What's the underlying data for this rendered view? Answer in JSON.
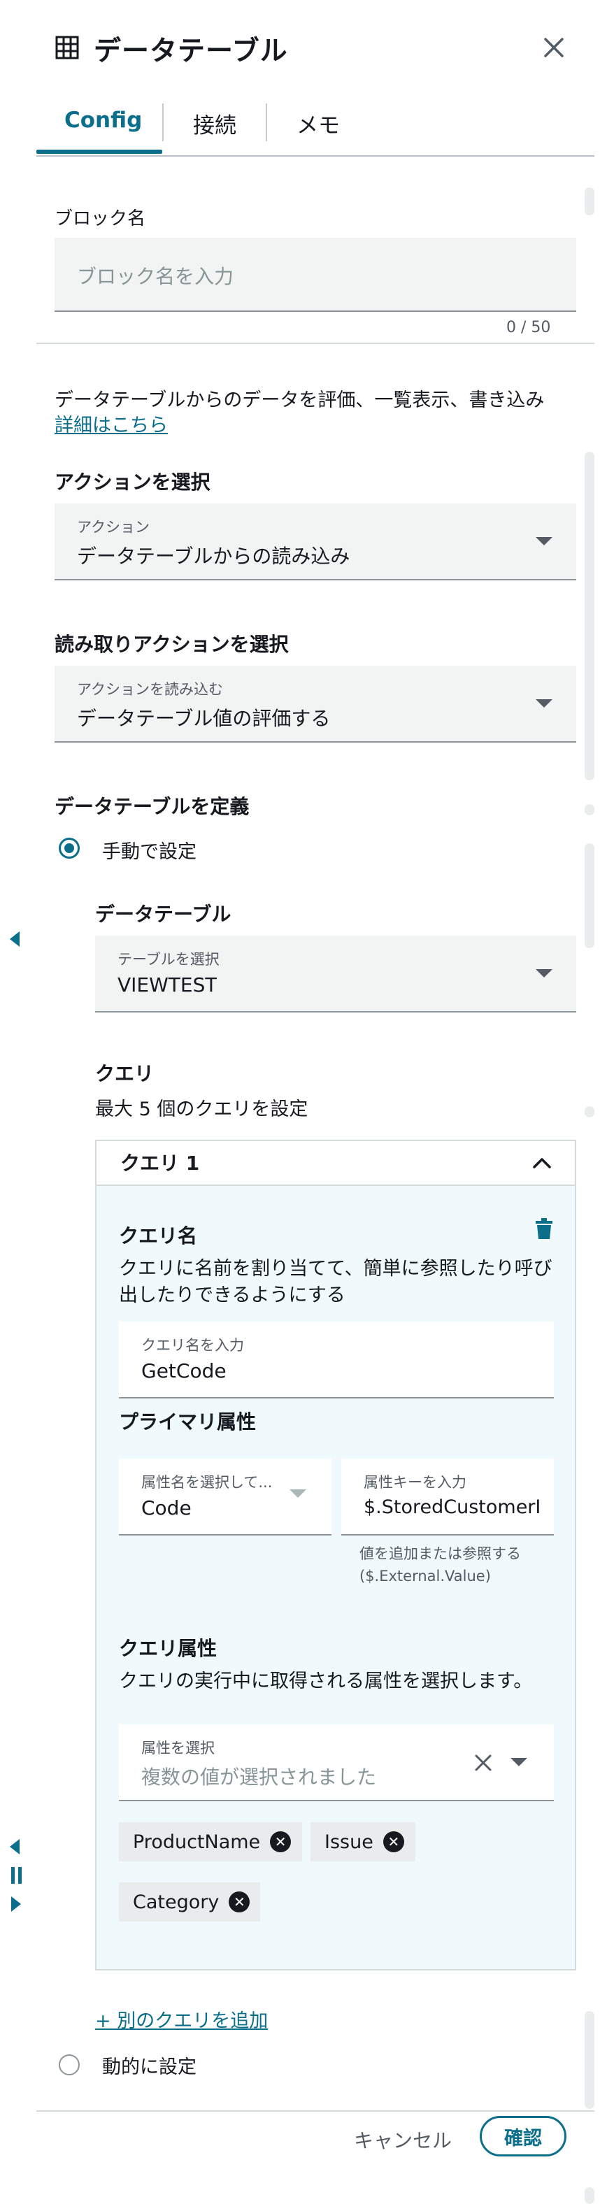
{
  "header": {
    "title": "データテーブル"
  },
  "tabs": [
    {
      "label": "Config"
    },
    {
      "label": "接続"
    },
    {
      "label": "メモ"
    }
  ],
  "block_name": {
    "label": "ブロック名",
    "placeholder": "ブロック名を入力",
    "counter": "0 / 50"
  },
  "intro": {
    "description": "データテーブルからのデータを評価、一覧表示、書き込み",
    "link": "詳細はこちら"
  },
  "action": {
    "heading": "アクションを選択",
    "field_label": "アクション",
    "value": "データテーブルからの読み込み"
  },
  "read_action": {
    "heading": "読み取りアクションを選択",
    "field_label": "アクションを読み込む",
    "value": "データテーブル値の評価する"
  },
  "define_table": {
    "heading": "データテーブルを定義",
    "manual_label": "手動で設定",
    "dynamic_label": "動的に設定"
  },
  "table": {
    "heading": "データテーブル",
    "field_label": "テーブルを選択",
    "value": "VIEWTEST"
  },
  "queries": {
    "heading": "クエリ",
    "subtext": "最大 5 個のクエリを設定",
    "add_link": "+ 別のクエリを追加",
    "items": [
      {
        "title": "クエリ 1",
        "name_heading": "クエリ名",
        "name_desc": "クエリに名前を割り当てて、簡単に参照したり呼び出したりできるようにする",
        "name_field_label": "クエリ名を入力",
        "name_value": "GetCode",
        "primary_heading": "プライマリ属性",
        "attr_name_label": "属性名を選択して...",
        "attr_name_value": "Code",
        "attr_key_label": "属性キーを入力",
        "attr_key_value": "$.StoredCustomerI",
        "attr_key_hint": "値を追加または参照する ($.External.Value)",
        "query_attrs_heading": "クエリ属性",
        "query_attrs_desc": "クエリの実行中に取得される属性を選択します。",
        "select_label": "属性を選択",
        "select_placeholder": "複数の値が選択されました",
        "tokens": [
          "ProductName",
          "Issue",
          "Category"
        ]
      }
    ]
  },
  "footer": {
    "cancel": "キャンセル",
    "confirm": "確認"
  },
  "colors": {
    "accent": "#0b6e8a",
    "query_panel_bg": "#f0fafd",
    "field_bg": "#f2f3f3"
  },
  "icons": [
    "table-icon",
    "close-icon",
    "caret-down-icon",
    "chevron-up-icon",
    "trash-icon",
    "clear-icon",
    "token-remove-icon",
    "arrow-left-icon",
    "pause-icon",
    "arrow-right-icon"
  ]
}
